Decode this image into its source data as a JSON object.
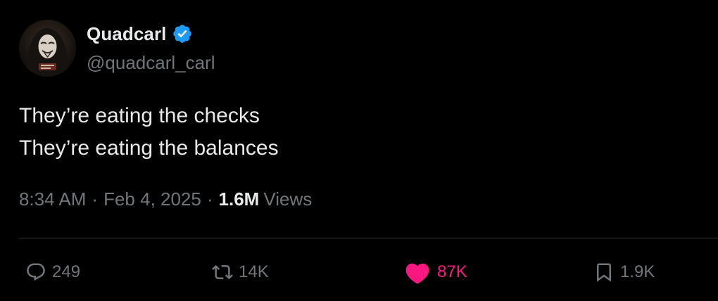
{
  "author": {
    "display_name": "Quadcarl",
    "handle": "@quadcarl_carl",
    "verified": true,
    "avatar_icon": "masked-person-avatar"
  },
  "tweet": {
    "lines": [
      "They’re eating the checks",
      "They’re eating the balances"
    ],
    "time": "8:34 AM",
    "separator": "·",
    "date": "Feb 4, 2025",
    "views_count": "1.6M",
    "views_label": "Views"
  },
  "actions": {
    "reply": {
      "icon": "reply-icon",
      "count": "249"
    },
    "repost": {
      "icon": "repost-icon",
      "count": "14K"
    },
    "like": {
      "icon": "heart-icon",
      "count": "87K",
      "active": true
    },
    "bookmark": {
      "icon": "bookmark-icon",
      "count": "1.9K"
    }
  },
  "colors": {
    "background": "#000000",
    "primary_text": "#e7e9ea",
    "secondary_text": "#71767b",
    "verified_badge": "#1d9bf0",
    "like_active": "#f91880",
    "divider": "#2f3336"
  }
}
